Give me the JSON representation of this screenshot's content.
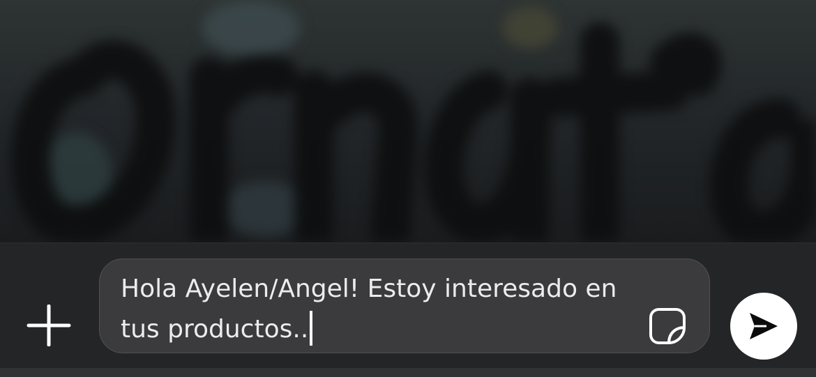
{
  "composer": {
    "message_text": "Hola Ayelen/Angel! Estoy interesado en tus productos..",
    "plus_icon": "plus-icon",
    "sticker_icon": "sticker-icon",
    "send_icon": "send-arrow-icon"
  },
  "colors": {
    "composer_background": "#232526",
    "input_background": "#3b3b3d",
    "text": "#ececee",
    "send_button": "#ffffff"
  }
}
